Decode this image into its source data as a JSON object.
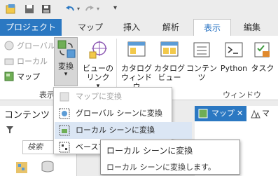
{
  "ribbon_tabs": [
    "プロジェクト",
    "マップ",
    "挿入",
    "解析",
    "表示",
    "編集"
  ],
  "view_group": {
    "buttons": [
      "グローバル",
      "ローカル",
      "マップ"
    ],
    "convert_label": "変換",
    "link_views_label": [
      "ビューの",
      "リンク"
    ],
    "group_label": "表示"
  },
  "window_group": {
    "buttons": [
      [
        "カタログ",
        "ウィンドウ"
      ],
      [
        "カタログ",
        "ビュー"
      ],
      [
        "コンテンツ"
      ],
      [
        "Python"
      ],
      [
        "タスク"
      ]
    ],
    "group_label": "ウィンドウ"
  },
  "convert_menu": {
    "items": [
      "マップに変換",
      "グローバル シーンに変換",
      "ローカル シーンに変換",
      "ベースマ"
    ]
  },
  "contents_pane": {
    "title": "コンテンツ",
    "search_placeholder": "検索"
  },
  "map_tab": {
    "label": "マップ",
    "second_label": "マ"
  },
  "tooltip": {
    "title": "ローカル シーンに変換",
    "description": "ローカル シーンに変換します。"
  },
  "colors": {
    "accent": "#2b78c2",
    "highlight": "#dbe6f4"
  }
}
